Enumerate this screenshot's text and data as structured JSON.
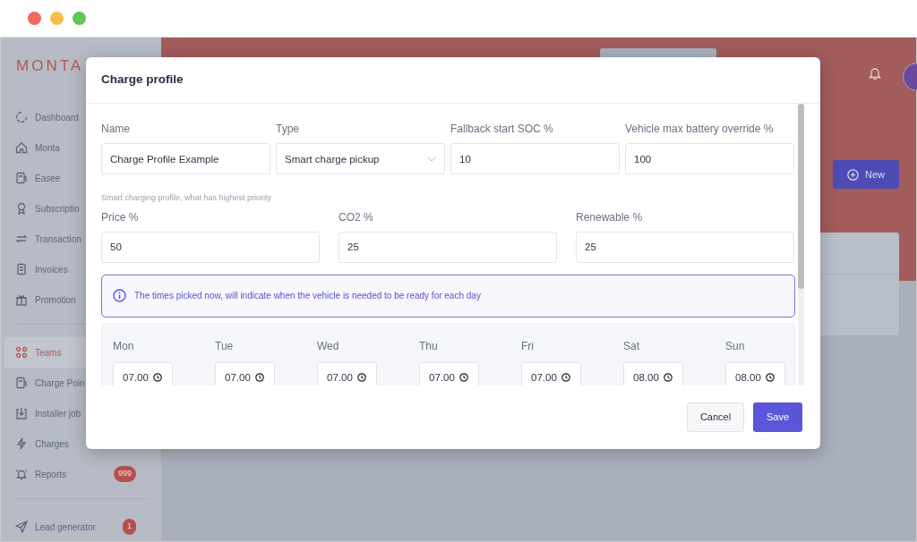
{
  "sidebar": {
    "logo": "MONTA",
    "groups": [
      [
        {
          "label": "Dashboard",
          "selected": false
        },
        {
          "label": "Monta",
          "selected": false
        },
        {
          "label": "Easee",
          "selected": false
        },
        {
          "label": "Subscriptio",
          "selected": false
        },
        {
          "label": "Transaction",
          "selected": false
        },
        {
          "label": "Invoices",
          "selected": false
        },
        {
          "label": "Promotion",
          "selected": false
        }
      ],
      [
        {
          "label": "Teams",
          "selected": true
        },
        {
          "label": "Charge Poin",
          "selected": false
        },
        {
          "label": "Installer job",
          "selected": false
        },
        {
          "label": "Charges",
          "selected": false
        },
        {
          "label": "Reports",
          "selected": false,
          "badge": "999"
        }
      ],
      [
        {
          "label": "Lead generator",
          "selected": false,
          "badge": "1"
        }
      ]
    ]
  },
  "header": {
    "new_button": "New"
  },
  "modal": {
    "title": "Charge profile",
    "fields": [
      {
        "label": "Name",
        "value": "Charge Profile Example",
        "kind": "text"
      },
      {
        "label": "Type",
        "value": "Smart charge pickup",
        "kind": "select"
      },
      {
        "label": "Fallback start SOC %",
        "value": "10",
        "kind": "text"
      },
      {
        "label": "Vehicle max battery override %",
        "value": "100",
        "kind": "text"
      }
    ],
    "hint": "Smart charging profile, what has highest priority",
    "priority_fields": [
      {
        "label": "Price %",
        "value": "50"
      },
      {
        "label": "CO2 %",
        "value": "25"
      },
      {
        "label": "Renewable %",
        "value": "25"
      }
    ],
    "alert": "The times picked now, will indicate when the vehicle is needed to be ready for each day",
    "days": [
      {
        "day": "Mon",
        "time": "07.00"
      },
      {
        "day": "Tue",
        "time": "07.00"
      },
      {
        "day": "Wed",
        "time": "07.00"
      },
      {
        "day": "Thu",
        "time": "07.00"
      },
      {
        "day": "Fri",
        "time": "07.00"
      },
      {
        "day": "Sat",
        "time": "08.00"
      },
      {
        "day": "Sun",
        "time": "08.00"
      }
    ],
    "buttons": {
      "cancel": "Cancel",
      "save": "Save"
    }
  }
}
